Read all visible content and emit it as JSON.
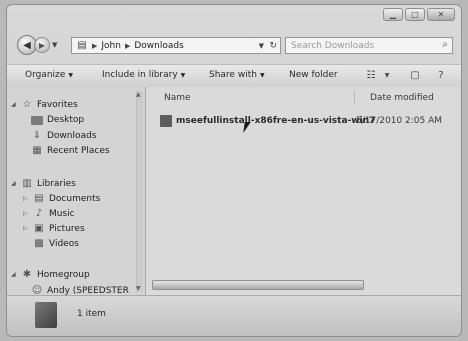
{
  "window": {
    "controls": {
      "minimize": "▁",
      "maximize": "□",
      "close": "✕"
    }
  },
  "address": {
    "crumbs": [
      "John",
      "Downloads"
    ],
    "search_placeholder": "Search Downloads"
  },
  "toolbar": {
    "organize": "Organize",
    "include_in_library": "Include in library",
    "share_with": "Share with",
    "new_folder": "New folder"
  },
  "nav": {
    "favorites": "Favorites",
    "desktop": "Desktop",
    "downloads": "Downloads",
    "recent_places": "Recent Places",
    "libraries": "Libraries",
    "documents": "Documents",
    "music": "Music",
    "pictures": "Pictures",
    "videos": "Videos",
    "homegroup": "Homegroup",
    "andy": "Andy (SPEEDSTER"
  },
  "files": {
    "columns": {
      "name": "Name",
      "date_modified": "Date modified"
    },
    "rows": [
      {
        "name": "mseefullinstall-x86fre-en-us-vista-win7",
        "date": "5/17/2010 2:05 AM"
      }
    ]
  },
  "details": {
    "count": "1 item"
  },
  "colors": {
    "window_bg": "#d4d4d4",
    "border": "#8f8f8f"
  }
}
